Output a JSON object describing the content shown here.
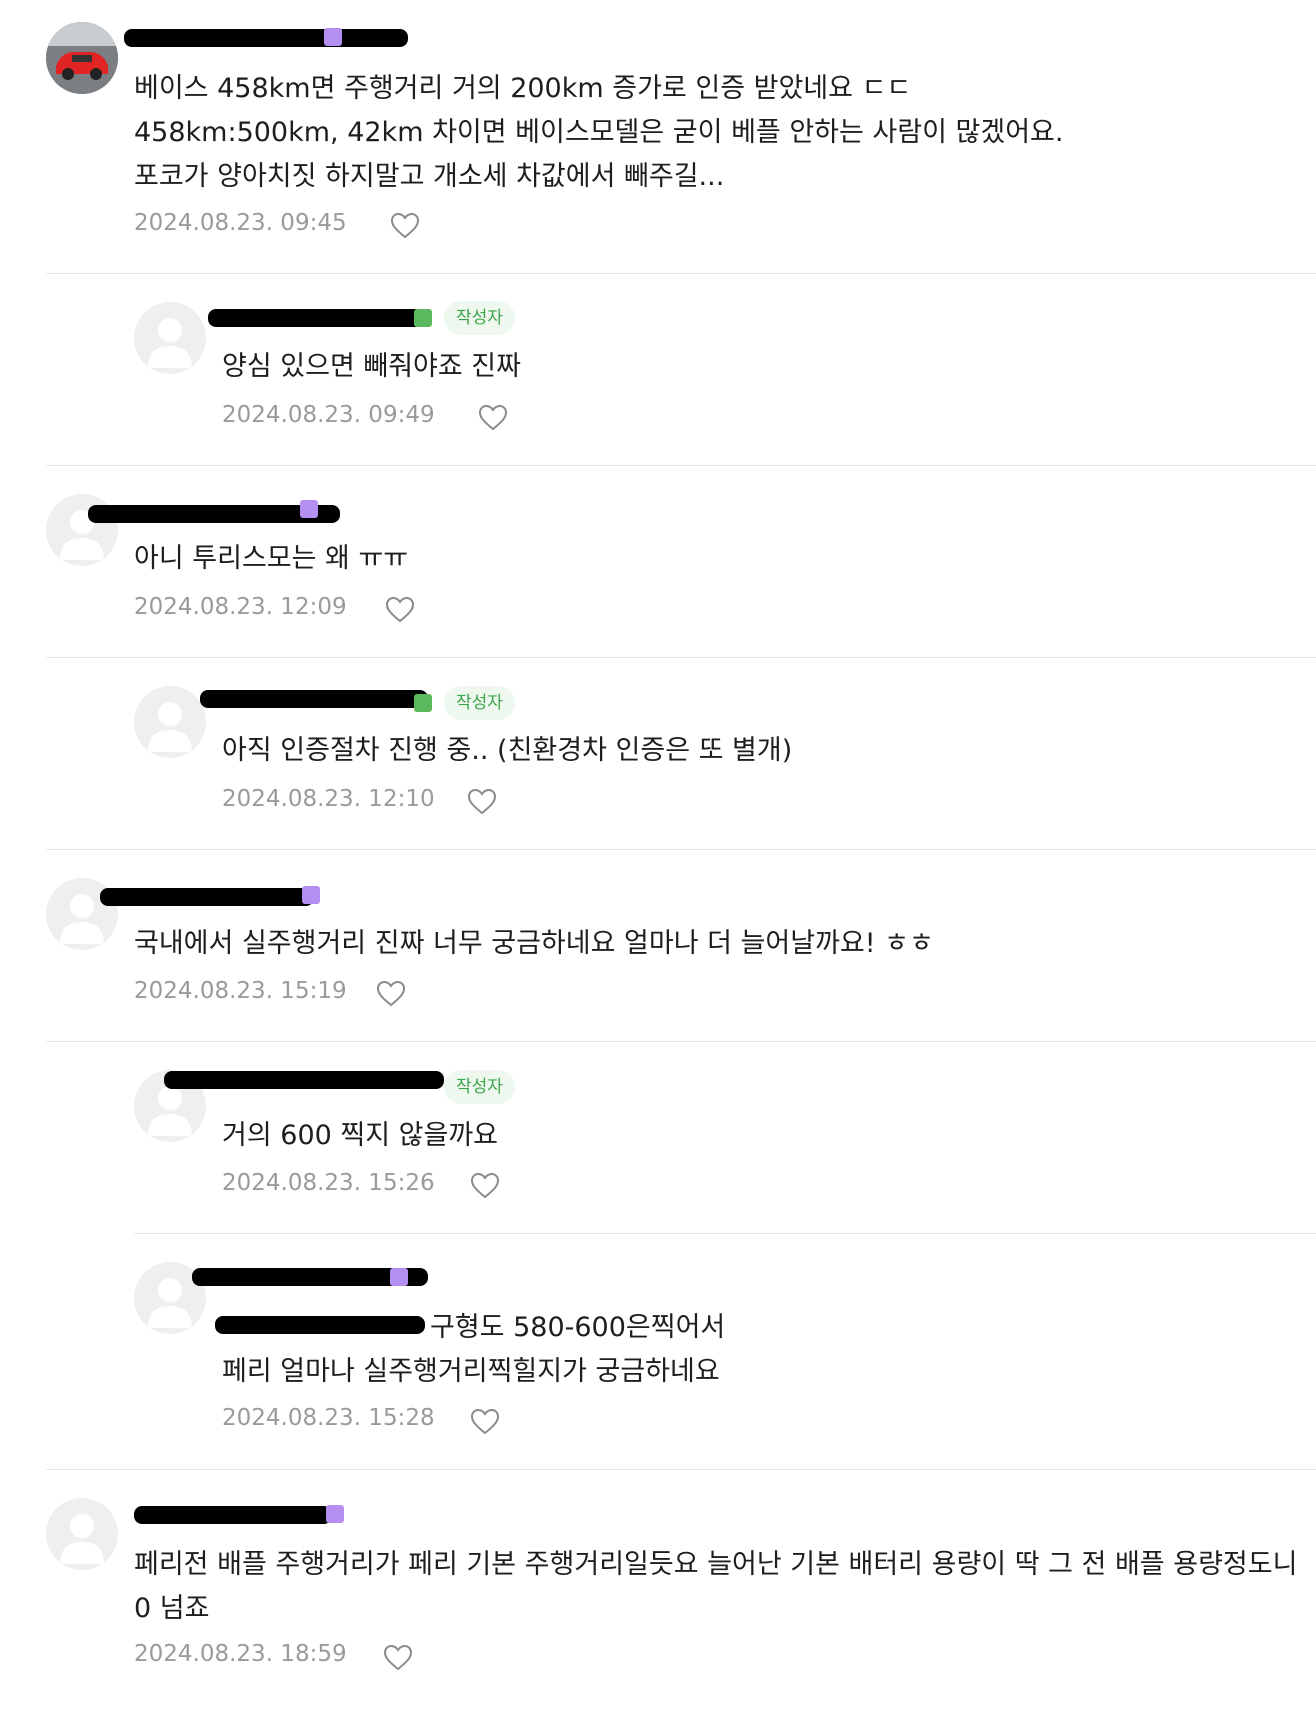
{
  "comments": [
    {
      "text_lines": [
        "베이스 458km면 주행거리 거의 200km 증가로 인증 받았네요 ㄷㄷ",
        "458km:500km, 42km 차이면 베이스모델은 굳이 베플 안하는 사람이 많겠어요.",
        "포코가 양아치짓 하지말고 개소세 차값에서 빼주길..."
      ],
      "date": "2024.08.23. 09:45",
      "is_reply": false,
      "author_badge": ""
    },
    {
      "text_lines": [
        "양심 있으면 빼줘야죠 진짜"
      ],
      "date": "2024.08.23. 09:49",
      "is_reply": true,
      "author_badge": "작성자"
    },
    {
      "text_lines": [
        "아니 투리스모는 왜 ㅠㅠ"
      ],
      "date": "2024.08.23. 12:09",
      "is_reply": false,
      "author_badge": ""
    },
    {
      "text_lines": [
        "아직 인증절차 진행 중.. (친환경차 인증은 또 별개)"
      ],
      "date": "2024.08.23. 12:10",
      "is_reply": true,
      "author_badge": "작성자"
    },
    {
      "text_lines": [
        "국내에서 실주행거리 진짜 너무 궁금하네요 얼마나 더 늘어날까요! ㅎㅎ"
      ],
      "date": "2024.08.23. 15:19",
      "is_reply": false,
      "author_badge": ""
    },
    {
      "text_lines": [
        "거의 600 찍지 않을까요"
      ],
      "date": "2024.08.23. 15:26",
      "is_reply": true,
      "author_badge": "작성자"
    },
    {
      "text_lines": [
        "구형도 580-600은찍어서",
        "페리 얼마나 실주행거리찍힐지가 궁금하네요"
      ],
      "date": "2024.08.23. 15:28",
      "is_reply": true,
      "author_badge": ""
    },
    {
      "text_lines": [
        "페리전 배플 주행거리가 페리 기본 주행거리일듯요 늘어난 기본 배터리 용량이 딱 그 전 배플 용량정도니",
        "0 넘죠"
      ],
      "date": "2024.08.23. 18:59",
      "is_reply": false,
      "author_badge": ""
    }
  ],
  "colors": {
    "author_badge_bg": "#eef8ee",
    "author_badge_text": "#3ca54b",
    "level_badge": "#b48ef0",
    "mention": "#2f5cd9"
  },
  "icons": {
    "like": "heart-outline-icon",
    "avatar": "default-profile-icon"
  }
}
